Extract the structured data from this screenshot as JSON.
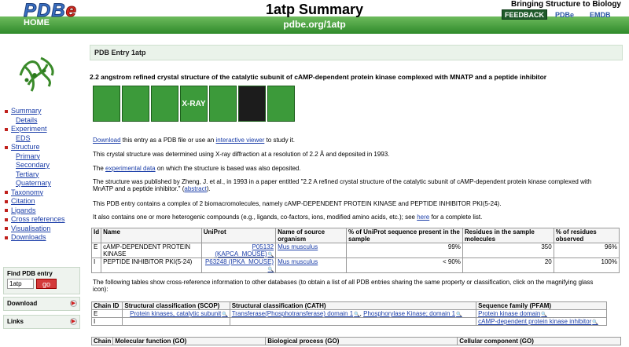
{
  "header": {
    "logo": "PDB",
    "logo_e": "e",
    "home": "HOME",
    "title": "1atp Summary",
    "url": "pdbe.org/1atp",
    "tagline": "Bringing Structure to Biology",
    "feedback": "FEEDBACK",
    "pdbe_small": "PDBe",
    "emdb": "EMDB"
  },
  "sidebar": {
    "nav": [
      {
        "label": "Summary",
        "level": "top"
      },
      {
        "label": "Details",
        "level": "sub"
      },
      {
        "label": "Experiment",
        "level": "top"
      },
      {
        "label": "EDS",
        "level": "sub"
      },
      {
        "label": "Structure",
        "level": "top"
      },
      {
        "label": "Primary",
        "level": "sub"
      },
      {
        "label": "Secondary",
        "level": "sub"
      },
      {
        "label": "Tertiary",
        "level": "sub"
      },
      {
        "label": "Quaternary",
        "level": "sub"
      },
      {
        "label": "Taxonomy",
        "level": "top"
      },
      {
        "label": "Citation",
        "level": "top"
      },
      {
        "label": "Ligands",
        "level": "top"
      },
      {
        "label": "Cross references",
        "level": "top"
      },
      {
        "label": "Visualisation",
        "level": "top"
      },
      {
        "label": "Downloads",
        "level": "top"
      }
    ],
    "find_title": "Find PDB entry",
    "find_value": "1atp",
    "go": "go",
    "download": "Download",
    "links": "Links"
  },
  "main": {
    "entry_header": "PDB Entry 1atp",
    "title": "2.2 angstrom refined crystal structure of the catalytic subunit of cAMP-dependent protein kinase complexed with MNATP and a peptide inhibitor",
    "icon_xray": "X-RAY",
    "p1_link1": "Download",
    "p1_mid": " this entry as a PDB file or use an ",
    "p1_link2": "interactive viewer",
    "p1_end": " to study it.",
    "p2": "This crystal structure was determined using X-ray diffraction at a resolution of 2.2 Å and deposited in 1993.",
    "p3_pre": "The ",
    "p3_link": "experimental data",
    "p3_end": " on which the structure is based was also deposited.",
    "p4_line1": "The structure was published by Zheng, J. et al., in 1993 in a paper entitled \"2.2 A refined crystal structure of the catalytic subunit of cAMP-dependent protein kinase complexed with",
    "p4_line2": "MnATP and a peptide inhibitor.\" (",
    "p4_link": "abstract",
    "p4_end": ").",
    "p5": "This PDB entry contains a complex of 2 biomacromolecules, namely cAMP-DEPENDENT PROTEIN KINASE and PEPTIDE INHIBITOR PKI(5-24).",
    "p6_pre": "It also contains one or more heterogenic compounds (e.g., ligands, co-factors, ions, modified amino acids, etc.); see ",
    "p6_link": "here",
    "p6_end": " for a complete list.",
    "t1_headers": [
      "Id",
      "Name",
      "UniProt",
      "Name of source organism",
      "% of UniProt sequence present in the sample",
      "Residues in the sample molecules",
      "% of residues observed"
    ],
    "t1_rows": [
      {
        "id": "E",
        "name": "cAMP-DEPENDENT PROTEIN KINASE",
        "uni1": "P05132",
        "uni2": "(KAPCA_MOUSE)",
        "org": "Mus musculus",
        "pct": "99%",
        "res": "350",
        "obs": "96%"
      },
      {
        "id": "I",
        "name": "PEPTIDE INHIBITOR PKI(5-24)",
        "uni1": "P63248 (IPKA_MOUSE)",
        "uni2": "",
        "org": "Mus musculus",
        "pct": "< 90%",
        "res": "20",
        "obs": "100%"
      }
    ],
    "p7_line1": "The following tables show cross-reference information to other databases (to obtain a list of all PDB entries sharing the same property or classification, click on the magnifying glass",
    "p7_line2": "icon):",
    "t2_headers": [
      "Chain ID",
      "Structural classification (SCOP)",
      "Structural classification (CATH)",
      "Sequence family (PFAM)"
    ],
    "t2_rows": [
      {
        "chain": "E",
        "scop": "Protein kinases, catalytic subunit",
        "cath1": "Transferase(Phosphotransferase) domain 1",
        "cath2": "Phosphorylase Kinase; domain 1",
        "pfam": "Protein kinase domain"
      },
      {
        "chain": "I",
        "scop": "",
        "cath1": "",
        "cath2": "",
        "pfam": "cAMP-dependent protein kinase inhibitor"
      }
    ],
    "t3_headers": [
      "Chain",
      "Molecular function (GO)",
      "Biological process (GO)",
      "Cellular component (GO)"
    ]
  }
}
